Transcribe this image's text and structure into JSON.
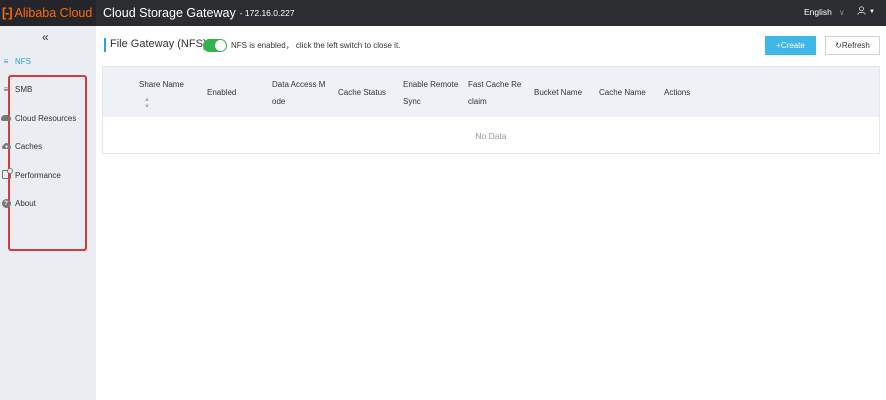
{
  "header": {
    "brand": "Alibaba Cloud",
    "logo_mark": "[-]",
    "app_title": "Cloud Storage Gateway",
    "ip": "- 172.16.0.227",
    "language": "English",
    "user_icon": "user-icon"
  },
  "sidebar": {
    "collapse": "«",
    "items": [
      {
        "label": "NFS",
        "icon": "list-icon",
        "active": true
      },
      {
        "label": "SMB",
        "icon": "list-icon",
        "active": false
      },
      {
        "label": "Cloud Resources",
        "icon": "cloud-icon",
        "active": false
      },
      {
        "label": "Caches",
        "icon": "cloud-upload-icon",
        "active": false
      },
      {
        "label": "Performance",
        "icon": "performance-icon",
        "active": false
      },
      {
        "label": "About",
        "icon": "question-icon",
        "active": false
      }
    ]
  },
  "main": {
    "title": "File Gateway (NFS)",
    "toggle_enabled": true,
    "toggle_text": "NFS is enabled， click the left switch to close it.",
    "create_label": "+Create",
    "refresh_label": "↻Refresh",
    "table": {
      "columns": [
        {
          "label": "Share Name",
          "sortable": true
        },
        {
          "label": "Enabled"
        },
        {
          "label": "Data Access M ode"
        },
        {
          "label": "Cache Status"
        },
        {
          "label": "Enable Remote Sync"
        },
        {
          "label": "Fast Cache Re claim"
        },
        {
          "label": "Bucket Name"
        },
        {
          "label": "Cache Name"
        },
        {
          "label": "Actions"
        }
      ],
      "rows": [],
      "empty_text": "No Data"
    }
  },
  "colors": {
    "accent": "#2c9fe5",
    "create_button": "#3fb7e8",
    "toggle_on": "#36b24a",
    "brand": "#ff6a00",
    "highlight_box": "#d63b3b"
  }
}
